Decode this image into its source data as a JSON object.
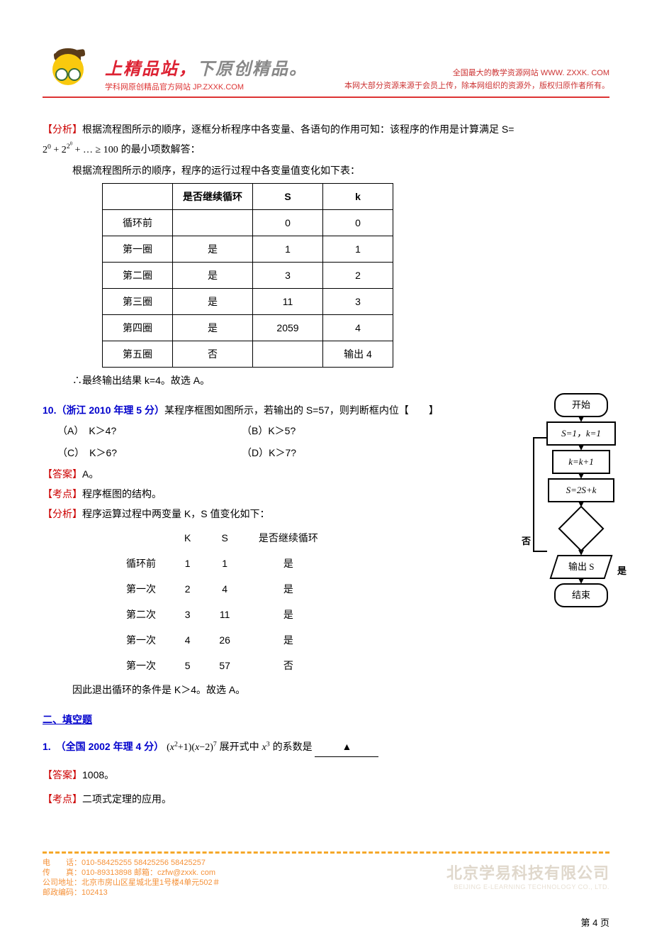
{
  "header": {
    "slogan_a": "上精品站，",
    "slogan_b": "下原创精品。",
    "subsite": "学科网原创精品官方网站 JP.ZXXK.COM",
    "right1": "全国最大的教学资源网站 WWW. ZXXK. COM",
    "right2": "本网大部分资源来源于会员上传，除本网组织的资源外，版权归原作者所有。"
  },
  "q9": {
    "analysis_label": "【分析】",
    "analysis_text1": "根据流程图所示的顺序，逐框分析程序中各变量、各语句的作用可知：该程序的作用是计算满足 S=",
    "analysis_text2": " 的最小项数解答：",
    "formula_tex": "2⁰ + 2^{2⁰} + … ≥ 100",
    "table_intro": "根据流程图所示的顺序，程序的运行过程中各变量值变化如下表：",
    "table": {
      "headers": [
        "",
        "是否继续循环",
        "S",
        "k"
      ],
      "rows": [
        [
          "循环前",
          "",
          "0",
          "0"
        ],
        [
          "第一圈",
          "是",
          "1",
          "1"
        ],
        [
          "第二圈",
          "是",
          "3",
          "2"
        ],
        [
          "第三圈",
          "是",
          "11",
          "3"
        ],
        [
          "第四圈",
          "是",
          "2059",
          "4"
        ],
        [
          "第五圈",
          "否",
          "",
          "输出 4"
        ]
      ]
    },
    "conclusion": "∴最终输出结果 k=4。故选 A。"
  },
  "q10": {
    "title_lead": "10.（浙江 2010 年理 5 分）",
    "stem": "某程序框图如图所示，若输出的 S=57，则判断框内位【　　】",
    "choices": {
      "a": "（A）　K＞4?",
      "b": "（B）K＞5?",
      "c": "（C）　K＞6?",
      "d": "（D）K＞7?"
    },
    "answer_label": "【答案】",
    "answer": "A。",
    "topic_label": "【考点】",
    "topic": "程序框图的结构。",
    "analysis_label": "【分析】",
    "analysis": "程序运算过程中两变量 K，S 值变化如下：",
    "table": {
      "headers": [
        "",
        "K",
        "S",
        "是否继续循环"
      ],
      "rows": [
        [
          "循环前",
          "1",
          "1",
          "是"
        ],
        [
          "第一次",
          "2",
          "4",
          "是"
        ],
        [
          "第二次",
          "3",
          "11",
          "是"
        ],
        [
          "第一次",
          "4",
          "26",
          "是"
        ],
        [
          "第一次",
          "5",
          "57",
          "否"
        ]
      ]
    },
    "conclusion": "因此退出循环的条件是 K＞4。故选 A。"
  },
  "flowchart": {
    "start": "开始",
    "init": "S=1，k=1",
    "step1": "k=k+1",
    "step2": "S=2S+k",
    "no": "否",
    "yes": "是",
    "output": "输出 S",
    "end": "结束"
  },
  "section2": {
    "title": "二、填空题",
    "q1_lead": "1.　（全国 2002 年理 4 分）",
    "q1_stem_a": " 展开式中 ",
    "q1_stem_b": " 的系数是",
    "q1_formula": "(x²+1)(x−2)⁷",
    "q1_of": "x³",
    "q1_blank": "▲",
    "answer_label": "【答案】",
    "answer": "1008。",
    "topic_label": "【考点】",
    "topic": "二项式定理的应用。"
  },
  "footer": {
    "tel": "电　　话：010-58425255 58425256 58425257",
    "fax": "传　　真：010-89313898 邮箱：czfw@zxxk. com",
    "addr": "公司地址：北京市房山区星城北里1号楼4单元502＃",
    "zip": "邮政编码：102413",
    "brand_cn": "北京学易科技有限公司",
    "brand_en": "BEIJING E-LEARNING TECHNOLOGY CO., LTD.",
    "page": "第 4 页"
  }
}
